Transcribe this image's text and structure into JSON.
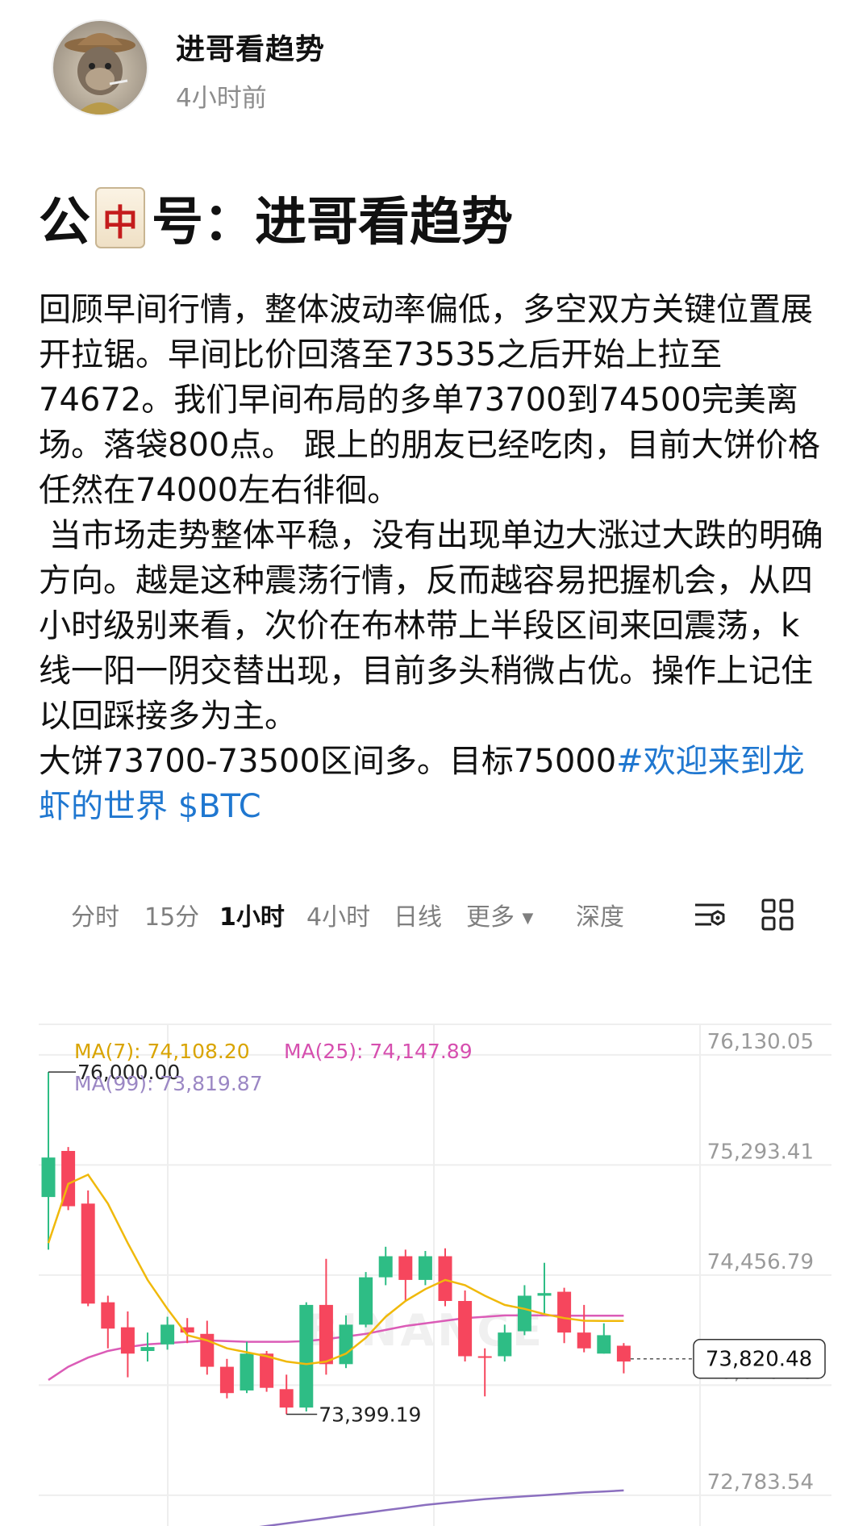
{
  "author": {
    "name": "进哥看趋势",
    "time": "4小时前"
  },
  "post": {
    "title_prefix": "公",
    "title_tile_icon": "mahjong-red-dragon-tile",
    "title_rest": "号：进哥看趋势",
    "paragraphs": [
      "回顾早间行情，整体波动率偏低，多空双方关键位置展开拉锯。早间比价回落至73535之后开始上拉至74672。我们早间布局的多单73700到74500完美离场。落袋800点。 跟上的朋友已经吃肉，目前大饼价格任然在74000左右徘徊。",
      " 当市场走势整体平稳，没有出现单边大涨过大跌的明确方向。越是这种震荡行情，反而越容易把握机会，从四小时级别来看，次价在布林带上半段区间来回震荡，k线一阳一阴交替出现，目前多头稍微占优。操作上记住以回踩接多为主。"
    ],
    "last_line": "大饼73700-73500区间多。目标75000",
    "hashtag": "#欢迎来到龙虾的世界",
    "cashtag": "$BTC"
  },
  "chart_tabs": {
    "items": [
      "分时",
      "15分",
      "1小时",
      "4小时",
      "日线",
      "更多",
      "深度"
    ],
    "active": "1小时",
    "more_caret": "▼",
    "icons": [
      "settings-sliders-icon",
      "grid-layout-icon"
    ]
  },
  "chart_data": {
    "type": "candlestick",
    "symbol": "BTC",
    "interval": "1小时",
    "ma_legend": {
      "ma7": "MA(7): 74,108.20",
      "ma25": "MA(25): 74,147.89",
      "ma99": "MA(99): 73,819.87"
    },
    "y_ticks": [
      "76,130.05",
      "75,293.41",
      "74,456.79",
      "73,620.16",
      "72,783.54"
    ],
    "y_tick_values": [
      76130.05,
      75293.41,
      74456.79,
      73620.16,
      72783.54
    ],
    "y_range": [
      72550,
      76350
    ],
    "current_price": "73,820.48",
    "current_price_value": 73820.48,
    "high_label": "76,000.00",
    "high_value": 76000.0,
    "low_label": "73,399.19",
    "low_value": 73399.19,
    "watermark": "BINANCE",
    "colors": {
      "up": "#2ebd85",
      "down": "#f6465d",
      "ma7": "#f0b90b",
      "ma25": "#db5cb7",
      "ma99": "#8b6fbf",
      "grid": "#eeeeee",
      "axis_text": "#9a9a9a"
    },
    "candles": [
      {
        "o": 75050,
        "h": 76000,
        "l": 74650,
        "c": 75350
      },
      {
        "o": 75400,
        "h": 75430,
        "l": 74950,
        "c": 74980
      },
      {
        "o": 75000,
        "h": 75100,
        "l": 74220,
        "c": 74240
      },
      {
        "o": 74250,
        "h": 74300,
        "l": 73900,
        "c": 74050
      },
      {
        "o": 74060,
        "h": 74180,
        "l": 73680,
        "c": 73860
      },
      {
        "o": 73880,
        "h": 74020,
        "l": 73800,
        "c": 73910
      },
      {
        "o": 73930,
        "h": 74140,
        "l": 73890,
        "c": 74080
      },
      {
        "o": 74060,
        "h": 74130,
        "l": 73940,
        "c": 74020
      },
      {
        "o": 74010,
        "h": 74110,
        "l": 73700,
        "c": 73760
      },
      {
        "o": 73760,
        "h": 73820,
        "l": 73520,
        "c": 73560
      },
      {
        "o": 73580,
        "h": 73950,
        "l": 73560,
        "c": 73860
      },
      {
        "o": 73860,
        "h": 73880,
        "l": 73570,
        "c": 73600
      },
      {
        "o": 73590,
        "h": 73700,
        "l": 73399.19,
        "c": 73450
      },
      {
        "o": 73450,
        "h": 74250,
        "l": 73420,
        "c": 74230
      },
      {
        "o": 74230,
        "h": 74580,
        "l": 73700,
        "c": 73780
      },
      {
        "o": 73780,
        "h": 74150,
        "l": 73750,
        "c": 74080
      },
      {
        "o": 74080,
        "h": 74480,
        "l": 74060,
        "c": 74440
      },
      {
        "o": 74440,
        "h": 74672,
        "l": 74380,
        "c": 74600
      },
      {
        "o": 74600,
        "h": 74650,
        "l": 74260,
        "c": 74420
      },
      {
        "o": 74420,
        "h": 74640,
        "l": 74380,
        "c": 74600
      },
      {
        "o": 74600,
        "h": 74660,
        "l": 74220,
        "c": 74260
      },
      {
        "o": 74260,
        "h": 74340,
        "l": 73800,
        "c": 73840
      },
      {
        "o": 73840,
        "h": 73900,
        "l": 73535,
        "c": 73830
      },
      {
        "o": 73840,
        "h": 74080,
        "l": 73800,
        "c": 74020
      },
      {
        "o": 74030,
        "h": 74380,
        "l": 74000,
        "c": 74300
      },
      {
        "o": 74300,
        "h": 74550,
        "l": 74160,
        "c": 74320
      },
      {
        "o": 74330,
        "h": 74360,
        "l": 73940,
        "c": 74020
      },
      {
        "o": 74020,
        "h": 74230,
        "l": 73870,
        "c": 73900
      },
      {
        "o": 73860,
        "h": 74090,
        "l": 73860,
        "c": 74000
      },
      {
        "o": 73920,
        "h": 73940,
        "l": 73710,
        "c": 73800
      }
    ],
    "ma7_values": [
      74700,
      75150,
      75220,
      75000,
      74700,
      74420,
      74200,
      74000,
      73960,
      73900,
      73870,
      73840,
      73800,
      73780,
      73800,
      73860,
      73980,
      74140,
      74260,
      74350,
      74420,
      74380,
      74300,
      74230,
      74200,
      74160,
      74130,
      74110,
      74108,
      74108
    ],
    "ma25_values": [
      73660,
      73760,
      73830,
      73880,
      73910,
      73930,
      73940,
      73950,
      73960,
      73955,
      73950,
      73950,
      73950,
      73955,
      73970,
      73990,
      74010,
      74040,
      74070,
      74090,
      74110,
      74130,
      74140,
      74150,
      74150,
      74150,
      74148,
      74148,
      74148,
      74148
    ],
    "ma99_values": [
      72330,
      72350,
      72370,
      72390,
      72410,
      72430,
      72450,
      72470,
      72490,
      72510,
      72530,
      72550,
      72570,
      72590,
      72610,
      72630,
      72650,
      72670,
      72690,
      72710,
      72725,
      72740,
      72755,
      72765,
      72775,
      72785,
      72795,
      72805,
      72812,
      72820
    ]
  }
}
